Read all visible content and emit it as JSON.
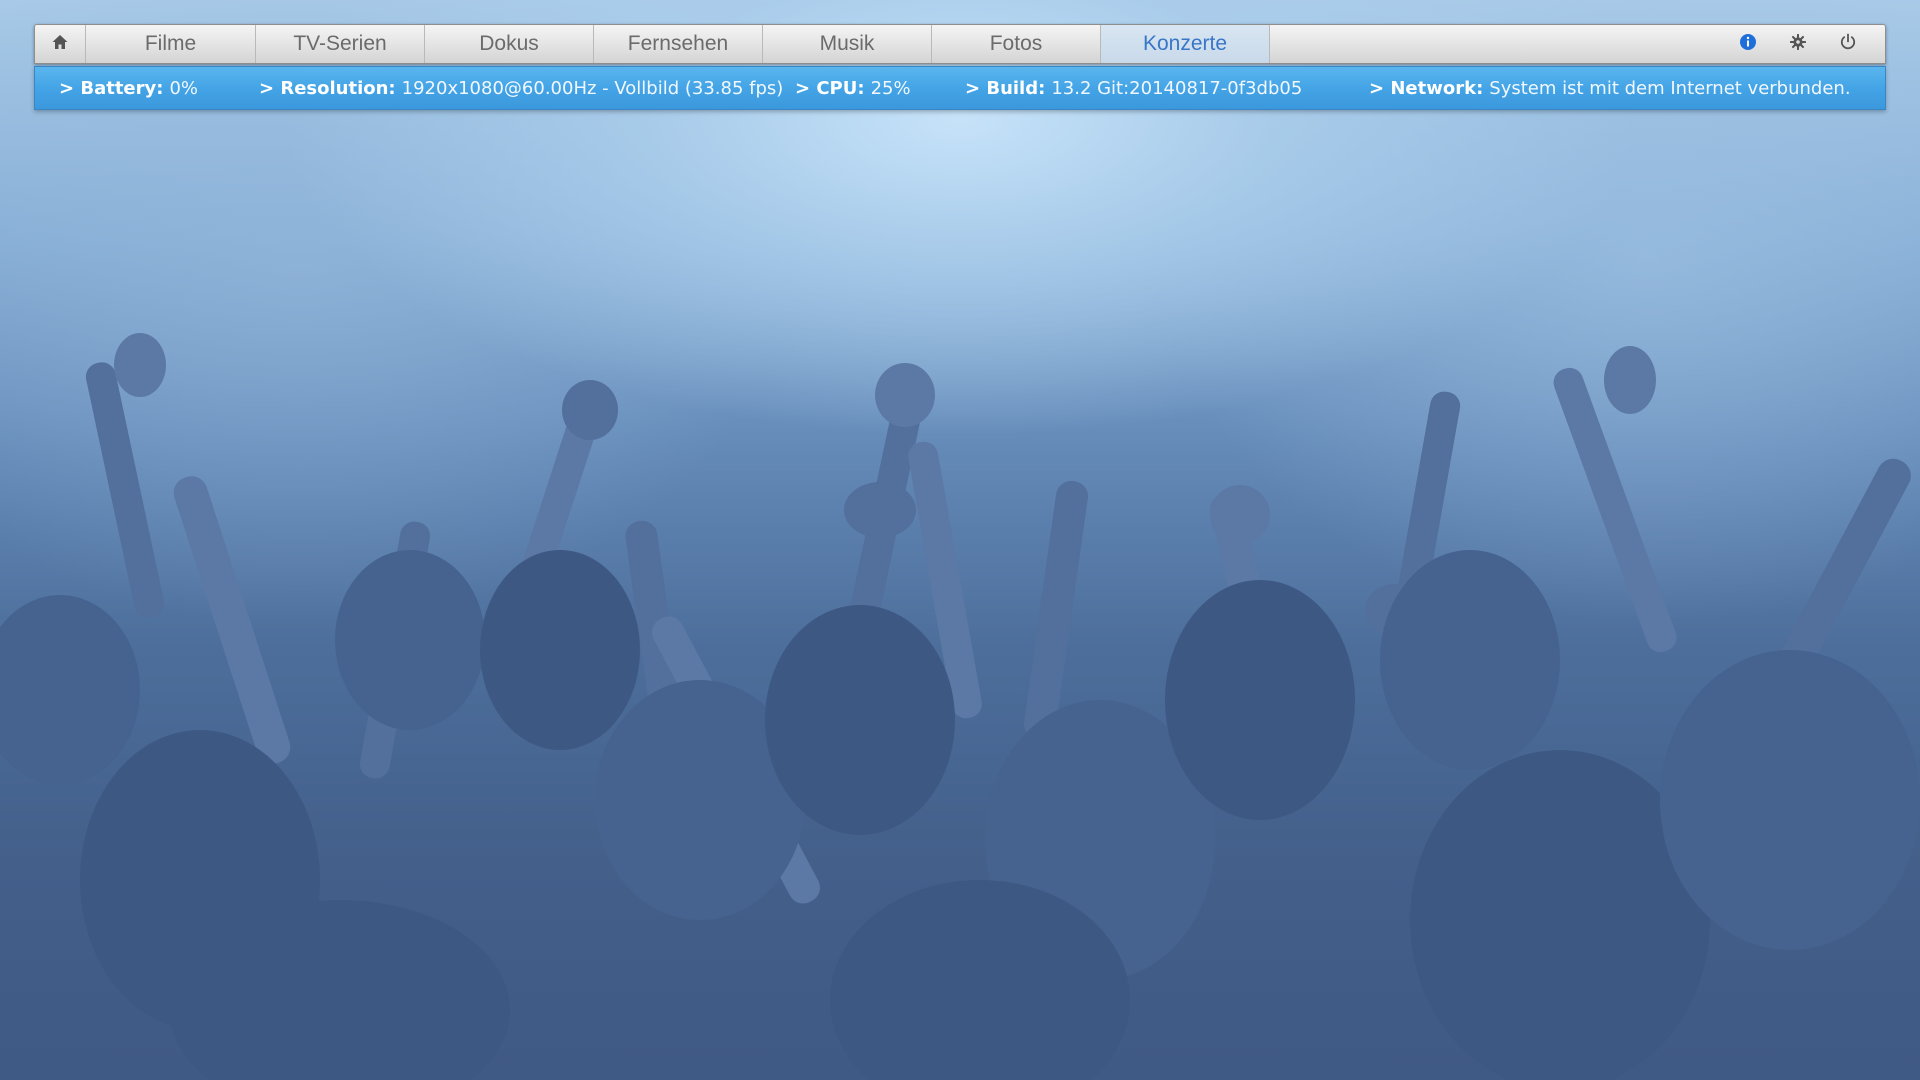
{
  "nav": {
    "tabs": [
      {
        "label": "Filme",
        "active": false
      },
      {
        "label": "TV-Serien",
        "active": false
      },
      {
        "label": "Dokus",
        "active": false
      },
      {
        "label": "Fernsehen",
        "active": false
      },
      {
        "label": "Musik",
        "active": false
      },
      {
        "label": "Fotos",
        "active": false
      },
      {
        "label": "Konzerte",
        "active": true
      }
    ],
    "icons": {
      "home": "home-icon",
      "info": "info-icon",
      "settings": "gear-icon",
      "power": "power-icon"
    }
  },
  "status": {
    "battery": {
      "label": "> Battery:",
      "value": "0%"
    },
    "resolution": {
      "label": "> Resolution:",
      "value": "1920x1080@60.00Hz - Vollbild (33.85 fps)"
    },
    "cpu": {
      "label": "> CPU:",
      "value": "25%"
    },
    "build": {
      "label": "> Build:",
      "value": "13.2 Git:20140817-0f3db05"
    },
    "network": {
      "label": "> Network:",
      "value": "System ist mit dem Internet verbunden."
    }
  },
  "colors": {
    "accent": "#3877c8",
    "status_bar": "#44a4e6",
    "info_icon": "#1e6fd9"
  }
}
